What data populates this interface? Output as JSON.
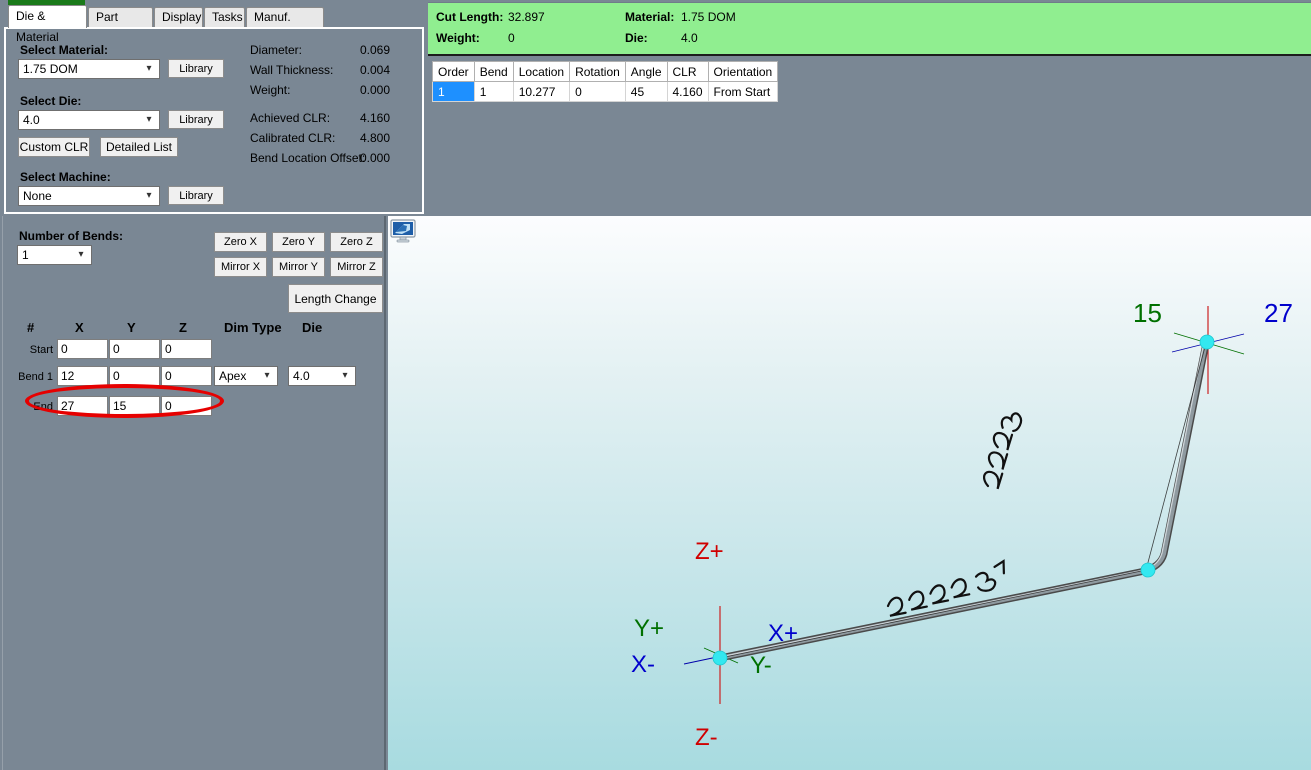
{
  "tabs": [
    {
      "label": "Die & Material",
      "active": true
    },
    {
      "label": "Part Details",
      "active": false
    },
    {
      "label": "Display",
      "active": false
    },
    {
      "label": "Tasks",
      "active": false
    },
    {
      "label": "Manuf. Warning",
      "active": false
    }
  ],
  "die_material": {
    "select_material_label": "Select Material:",
    "material_value": "1.75 DOM",
    "material_library_button": "Library",
    "select_die_label": "Select Die:",
    "die_value": "4.0",
    "die_library_button": "Library",
    "custom_clr_button": "Custom CLR",
    "detailed_list_button": "Detailed List",
    "select_machine_label": "Select Machine:",
    "machine_value": "None",
    "machine_library_button": "Library",
    "stats": [
      {
        "label": "Diameter:",
        "value": "0.069"
      },
      {
        "label": "Wall Thickness:",
        "value": "0.004"
      },
      {
        "label": "Weight:",
        "value": "0.000"
      },
      {
        "label": "Achieved CLR:",
        "value": "4.160"
      },
      {
        "label": "Calibrated CLR:",
        "value": "4.800"
      },
      {
        "label": "Bend Location Offset:",
        "value": "0.000"
      }
    ]
  },
  "summary": {
    "cut_length_label": "Cut Length:",
    "cut_length_value": "32.897",
    "weight_label": "Weight:",
    "weight_value": "0",
    "material_label": "Material:",
    "material_value": "1.75 DOM",
    "die_label": "Die:",
    "die_value": "4.0",
    "background_color": "#90ee90"
  },
  "bend_table": {
    "headers": [
      "Order",
      "Bend",
      "Location",
      "Rotation",
      "Angle",
      "CLR",
      "Orientation"
    ],
    "rows": [
      {
        "order": "1",
        "bend": "1",
        "location": "10.277",
        "rotation": "0",
        "angle": "45",
        "clr": "4.160",
        "orientation": "From Start",
        "selected": true
      }
    ],
    "selected_color": "#1e90ff"
  },
  "bends_panel": {
    "number_of_bends_label": "Number of Bends:",
    "number_of_bends_value": "1",
    "zero_buttons": [
      "Zero X",
      "Zero Y",
      "Zero Z"
    ],
    "mirror_buttons": [
      "Mirror X",
      "Mirror Y",
      "Mirror Z"
    ],
    "length_change_button": "Length Change",
    "columns": [
      "#",
      "X",
      "Y",
      "Z",
      "Dim Type",
      "Die"
    ],
    "rows": [
      {
        "label": "Start",
        "x": "0",
        "y": "0",
        "z": "0",
        "dim_type": "",
        "die": ""
      },
      {
        "label": "Bend 1",
        "x": "12",
        "y": "0",
        "z": "0",
        "dim_type": "Apex",
        "die": "4.0"
      },
      {
        "label": "End",
        "x": "27",
        "y": "15",
        "z": "0",
        "dim_type": "",
        "die": ""
      }
    ],
    "annotation_color": "#e60000"
  },
  "viewport": {
    "display_icon": "monitor-icon",
    "axis_labels": [
      {
        "text": "Z+",
        "color": "#d00000"
      },
      {
        "text": "Z-",
        "color": "#d00000"
      },
      {
        "text": "Y+",
        "color": "#007000"
      },
      {
        "text": "Y-",
        "color": "#007000"
      },
      {
        "text": "X+",
        "color": "#0000cc"
      },
      {
        "text": "X-",
        "color": "#0000cc"
      }
    ],
    "dimension_labels": [
      {
        "text": "15",
        "color": "#007000"
      },
      {
        "text": "27",
        "color": "#0000cc"
      }
    ],
    "node_color": "#33e8f0",
    "tube_color": "#3a3a3a"
  }
}
